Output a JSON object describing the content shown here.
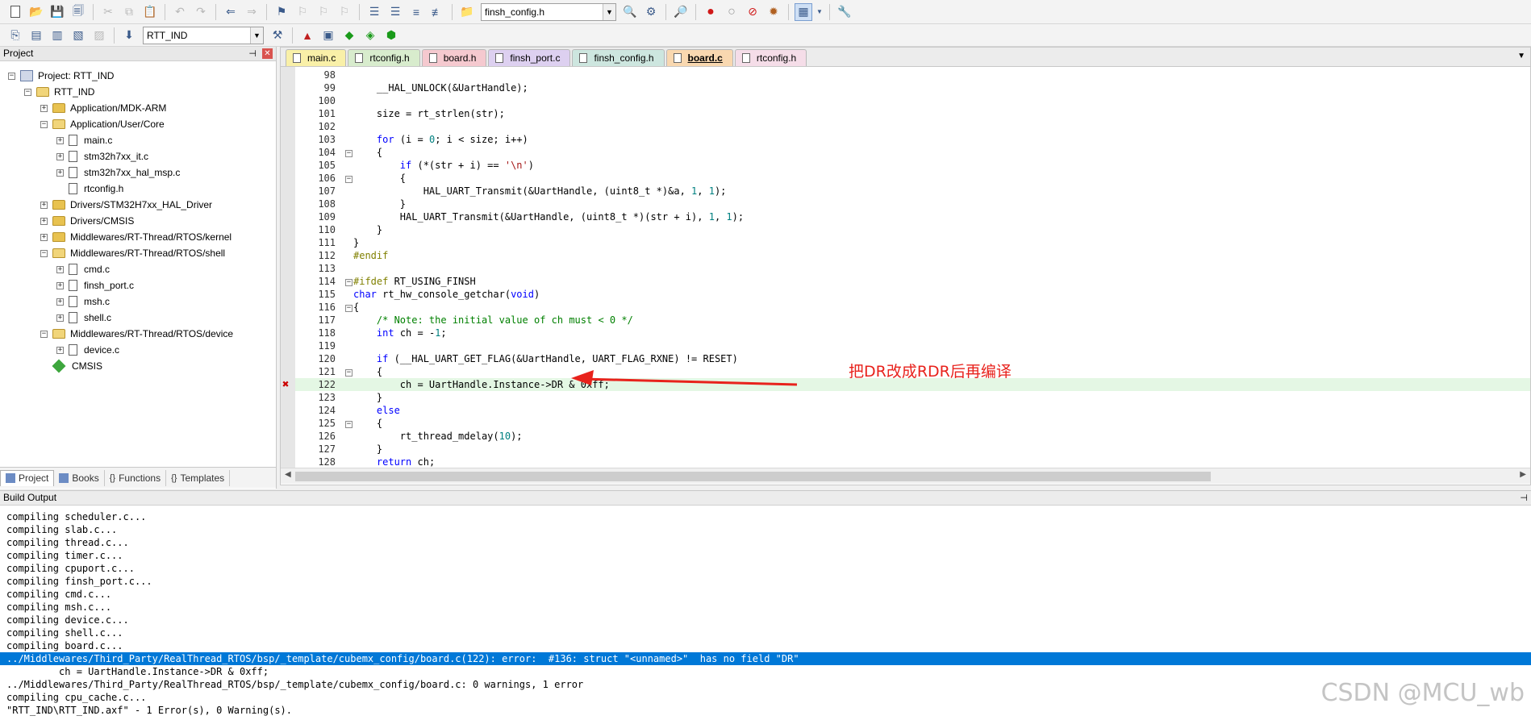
{
  "toolbar": {
    "target_file_combo": "finsh_config.h",
    "target_combo": "RTT_IND"
  },
  "project_panel": {
    "title": "Project",
    "tree": [
      {
        "label": "Project: RTT_IND",
        "level": 0,
        "type": "project",
        "expand": "-"
      },
      {
        "label": "RTT_IND",
        "level": 1,
        "type": "folder-open",
        "expand": "-"
      },
      {
        "label": "Application/MDK-ARM",
        "level": 2,
        "type": "folder",
        "expand": "+"
      },
      {
        "label": "Application/User/Core",
        "level": 2,
        "type": "folder-open",
        "expand": "-"
      },
      {
        "label": "main.c",
        "level": 3,
        "type": "file",
        "expand": "+"
      },
      {
        "label": "stm32h7xx_it.c",
        "level": 3,
        "type": "file",
        "expand": "+"
      },
      {
        "label": "stm32h7xx_hal_msp.c",
        "level": 3,
        "type": "file",
        "expand": "+"
      },
      {
        "label": "rtconfig.h",
        "level": 3,
        "type": "file",
        "expand": ""
      },
      {
        "label": "Drivers/STM32H7xx_HAL_Driver",
        "level": 2,
        "type": "folder",
        "expand": "+"
      },
      {
        "label": "Drivers/CMSIS",
        "level": 2,
        "type": "folder",
        "expand": "+"
      },
      {
        "label": "Middlewares/RT-Thread/RTOS/kernel",
        "level": 2,
        "type": "folder",
        "expand": "+"
      },
      {
        "label": "Middlewares/RT-Thread/RTOS/shell",
        "level": 2,
        "type": "folder-open",
        "expand": "-"
      },
      {
        "label": "cmd.c",
        "level": 3,
        "type": "file",
        "expand": "+"
      },
      {
        "label": "finsh_port.c",
        "level": 3,
        "type": "file",
        "expand": "+"
      },
      {
        "label": "msh.c",
        "level": 3,
        "type": "file",
        "expand": "+"
      },
      {
        "label": "shell.c",
        "level": 3,
        "type": "file",
        "expand": "+"
      },
      {
        "label": "Middlewares/RT-Thread/RTOS/device",
        "level": 2,
        "type": "folder-open",
        "expand": "-"
      },
      {
        "label": "device.c",
        "level": 3,
        "type": "file",
        "expand": "+"
      },
      {
        "label": "CMSIS",
        "level": 2,
        "type": "cmsis",
        "expand": ""
      }
    ],
    "tabs": [
      {
        "label": "Project",
        "icon": "project-icon",
        "active": true
      },
      {
        "label": "Books",
        "icon": "books-icon",
        "active": false
      },
      {
        "label": "Functions",
        "icon": "functions-icon",
        "active": false
      },
      {
        "label": "Templates",
        "icon": "templates-icon",
        "active": false
      }
    ]
  },
  "editor": {
    "tabs": [
      {
        "label": "main.c",
        "color": "#f9f0a8",
        "active": false
      },
      {
        "label": "rtconfig.h",
        "color": "#d8eccd",
        "active": false
      },
      {
        "label": "board.h",
        "color": "#f5c9cf",
        "active": false
      },
      {
        "label": "finsh_port.c",
        "color": "#ddd0f0",
        "active": false
      },
      {
        "label": "finsh_config.h",
        "color": "#cde6df",
        "active": false
      },
      {
        "label": "board.c",
        "color": "#f9d8b0",
        "active": true
      },
      {
        "label": "rtconfig.h",
        "color": "#f5dde8",
        "active": false
      }
    ],
    "lines": [
      {
        "n": "98",
        "fold": "",
        "code": []
      },
      {
        "n": "99",
        "fold": "",
        "code": [
          [
            "    __HAL_UNLOCK(&UartHandle);",
            ""
          ]
        ]
      },
      {
        "n": "100",
        "fold": "",
        "code": []
      },
      {
        "n": "101",
        "fold": "",
        "code": [
          [
            "    size = rt_strlen(str);",
            ""
          ]
        ]
      },
      {
        "n": "102",
        "fold": "",
        "code": []
      },
      {
        "n": "103",
        "fold": "",
        "code": [
          [
            "    ",
            ""
          ],
          [
            "for",
            "kw"
          ],
          [
            " (i = ",
            ""
          ],
          [
            "0",
            "num"
          ],
          [
            "; i < size; i++)",
            ""
          ]
        ]
      },
      {
        "n": "104",
        "fold": "-",
        "code": [
          [
            "    {",
            ""
          ]
        ]
      },
      {
        "n": "105",
        "fold": "",
        "code": [
          [
            "        ",
            ""
          ],
          [
            "if",
            "kw"
          ],
          [
            " (*(str + i) == ",
            ""
          ],
          [
            "'\\n'",
            "str"
          ],
          [
            ")",
            ""
          ]
        ]
      },
      {
        "n": "106",
        "fold": "-",
        "code": [
          [
            "        {",
            ""
          ]
        ]
      },
      {
        "n": "107",
        "fold": "",
        "code": [
          [
            "            HAL_UART_Transmit(&UartHandle, (uint8_t *)&a, ",
            ""
          ],
          [
            "1",
            "num"
          ],
          [
            ", ",
            ""
          ],
          [
            "1",
            "num"
          ],
          [
            ");",
            ""
          ]
        ]
      },
      {
        "n": "108",
        "fold": "",
        "code": [
          [
            "        }",
            ""
          ]
        ]
      },
      {
        "n": "109",
        "fold": "",
        "code": [
          [
            "        HAL_UART_Transmit(&UartHandle, (uint8_t *)(str + i), ",
            ""
          ],
          [
            "1",
            "num"
          ],
          [
            ", ",
            ""
          ],
          [
            "1",
            "num"
          ],
          [
            ");",
            ""
          ]
        ]
      },
      {
        "n": "110",
        "fold": "",
        "code": [
          [
            "    }",
            ""
          ]
        ]
      },
      {
        "n": "111",
        "fold": "",
        "code": [
          [
            "}",
            ""
          ]
        ]
      },
      {
        "n": "112",
        "fold": "",
        "code": [
          [
            "#endif",
            "pp"
          ]
        ]
      },
      {
        "n": "113",
        "fold": "",
        "code": []
      },
      {
        "n": "114",
        "fold": "-",
        "code": [
          [
            "#ifdef",
            "pp"
          ],
          [
            " RT_USING_FINSH",
            ""
          ]
        ]
      },
      {
        "n": "115",
        "fold": "",
        "code": [
          [
            "char",
            "kw"
          ],
          [
            " rt_hw_console_getchar(",
            ""
          ],
          [
            "void",
            "kw"
          ],
          [
            ")",
            ""
          ]
        ]
      },
      {
        "n": "116",
        "fold": "-",
        "code": [
          [
            "{",
            ""
          ]
        ]
      },
      {
        "n": "117",
        "fold": "",
        "code": [
          [
            "    ",
            ""
          ],
          [
            "/* Note: the initial value of ch must < 0 */",
            "cm"
          ]
        ]
      },
      {
        "n": "118",
        "fold": "",
        "code": [
          [
            "    ",
            ""
          ],
          [
            "int",
            "kw"
          ],
          [
            " ch = -",
            ""
          ],
          [
            "1",
            "num"
          ],
          [
            ";",
            ""
          ]
        ]
      },
      {
        "n": "119",
        "fold": "",
        "code": []
      },
      {
        "n": "120",
        "fold": "",
        "code": [
          [
            "    ",
            ""
          ],
          [
            "if",
            "kw"
          ],
          [
            " (__HAL_UART_GET_FLAG(&UartHandle, UART_FLAG_RXNE) != RESET)",
            ""
          ]
        ]
      },
      {
        "n": "121",
        "fold": "-",
        "code": [
          [
            "    {",
            ""
          ]
        ]
      },
      {
        "n": "122",
        "fold": "",
        "code": [
          [
            "        ch = UartHandle.Instance->DR & 0xff;",
            ""
          ]
        ]
      },
      {
        "n": "123",
        "fold": "",
        "code": [
          [
            "    }",
            ""
          ]
        ]
      },
      {
        "n": "124",
        "fold": "",
        "code": [
          [
            "    ",
            ""
          ],
          [
            "else",
            "kw"
          ]
        ]
      },
      {
        "n": "125",
        "fold": "-",
        "code": [
          [
            "    {",
            ""
          ]
        ]
      },
      {
        "n": "126",
        "fold": "",
        "code": [
          [
            "        rt_thread_mdelay(",
            ""
          ],
          [
            "10",
            "num"
          ],
          [
            ");",
            ""
          ]
        ]
      },
      {
        "n": "127",
        "fold": "",
        "code": [
          [
            "    }",
            ""
          ]
        ]
      },
      {
        "n": "128",
        "fold": "",
        "code": [
          [
            "    ",
            ""
          ],
          [
            "return",
            "kw"
          ],
          [
            " ch;",
            ""
          ]
        ]
      }
    ],
    "highlight_line": "122",
    "error_line": "122"
  },
  "annotation": {
    "text": "把DR改成RDR后再编译",
    "color": "#e8221c"
  },
  "build_output": {
    "title": "Build Output",
    "lines": [
      "compiling scheduler.c...",
      "compiling slab.c...",
      "compiling thread.c...",
      "compiling timer.c...",
      "compiling cpuport.c...",
      "compiling finsh_port.c...",
      "compiling cmd.c...",
      "compiling msh.c...",
      "compiling device.c...",
      "compiling shell.c...",
      "compiling board.c...",
      "../Middlewares/Third_Party/RealThread_RTOS/bsp/_template/cubemx_config/board.c(122): error:  #136: struct \"<unnamed>\"  has no field \"DR\"",
      "         ch = UartHandle.Instance->DR & 0xff;",
      "../Middlewares/Third_Party/RealThread_RTOS/bsp/_template/cubemx_config/board.c: 0 warnings, 1 error",
      "compiling cpu_cache.c...",
      "\"RTT_IND\\RTT_IND.axf\" - 1 Error(s), 0 Warning(s)."
    ],
    "selected_index": 11
  },
  "watermark": "CSDN @MCU_wb"
}
